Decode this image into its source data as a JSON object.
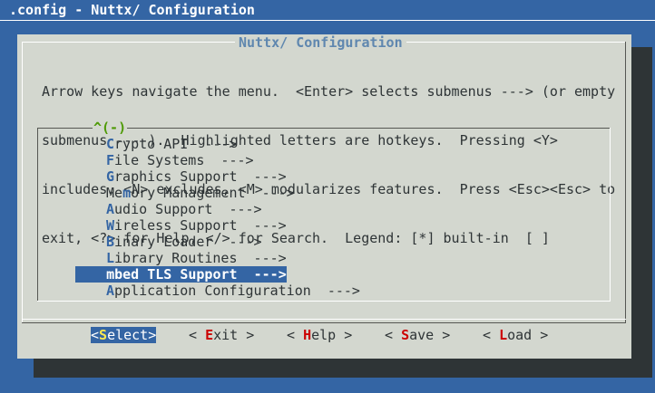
{
  "window": {
    "title": ".config - Nuttx/ Configuration"
  },
  "dialog": {
    "title": "Nuttx/ Configuration",
    "help_lines": [
      "Arrow keys navigate the menu.  <Enter> selects submenus ---> (or empty",
      "submenus ----).  Highlighted letters are hotkeys.  Pressing <Y>",
      "includes, <N> excludes, <M> modularizes features.  Press <Esc><Esc> to",
      "exit, <?> for Help, </> for Search.  Legend: [*] built-in  [ ]"
    ],
    "scroll_indicator": "^(-)"
  },
  "menu": {
    "items": [
      {
        "hotkey": "C",
        "rest": "rypto API  --->"
      },
      {
        "hotkey": "F",
        "rest": "ile Systems  --->"
      },
      {
        "hotkey": "G",
        "rest": "raphics Support  --->"
      },
      {
        "pre": "Me",
        "hotkey": "m",
        "rest": "ory Management  --->"
      },
      {
        "hotkey": "A",
        "rest": "udio Support  --->"
      },
      {
        "hotkey": "W",
        "rest": "ireless Support  --->"
      },
      {
        "hotkey": "B",
        "rest": "inary Loader  --->"
      },
      {
        "hotkey": "L",
        "rest": "ibrary Routines  --->"
      },
      {
        "pre": "m",
        "hotkey": "b",
        "rest": "ed TLS Support  --->"
      },
      {
        "hotkey": "A",
        "rest": "pplication Configuration  --->"
      }
    ],
    "selected_index": 8
  },
  "buttons": [
    {
      "pre": "<",
      "hotkey": "S",
      "rest": "elect>"
    },
    {
      "pre": "< ",
      "hotkey": "E",
      "rest": "xit >"
    },
    {
      "pre": "< ",
      "hotkey": "H",
      "rest": "elp >"
    },
    {
      "pre": "< ",
      "hotkey": "S",
      "rest": "ave >"
    },
    {
      "pre": "< ",
      "hotkey": "L",
      "rest": "oad >"
    }
  ],
  "colors": {
    "background": "#3465a4",
    "dialog": "#d3d7cf",
    "selection": "#3465a4",
    "hotkey_item": "#3465a4",
    "hotkey_button": "#cc0000",
    "scroll_indicator": "#4e9a06"
  }
}
